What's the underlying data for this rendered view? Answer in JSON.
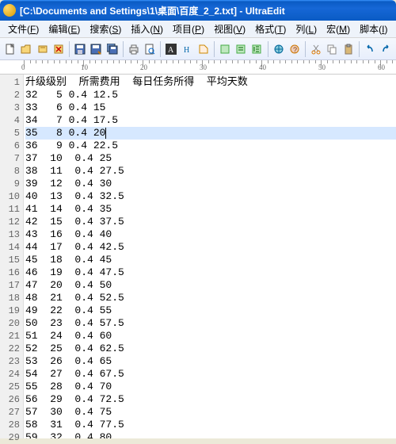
{
  "window": {
    "title": "[C:\\Documents and Settings\\1\\桌面\\百度_2_2.txt] - UltraEdit"
  },
  "menu": [
    {
      "label": "文件",
      "acc": "F"
    },
    {
      "label": "编辑",
      "acc": "E"
    },
    {
      "label": "搜索",
      "acc": "S"
    },
    {
      "label": "插入",
      "acc": "N"
    },
    {
      "label": "项目",
      "acc": "P"
    },
    {
      "label": "视图",
      "acc": "V"
    },
    {
      "label": "格式",
      "acc": "T"
    },
    {
      "label": "列",
      "acc": "L"
    },
    {
      "label": "宏",
      "acc": "M"
    },
    {
      "label": "脚本",
      "acc": "I"
    }
  ],
  "ruler": {
    "marks": [
      0,
      10,
      20,
      30,
      40,
      50,
      60
    ]
  },
  "selected_line": 5,
  "header_line": "升级级别  所需费用  每日任务所得  平均天数",
  "rows": [
    "32   5 0.4 12.5",
    "33   6 0.4 15",
    "34   7 0.4 17.5",
    "35   8 0.4 20",
    "36   9 0.4 22.5",
    "37  10  0.4 25",
    "38  11  0.4 27.5",
    "39  12  0.4 30",
    "40  13  0.4 32.5",
    "41  14  0.4 35",
    "42  15  0.4 37.5",
    "43  16  0.4 40",
    "44  17  0.4 42.5",
    "45  18  0.4 45",
    "46  19  0.4 47.5",
    "47  20  0.4 50",
    "48  21  0.4 52.5",
    "49  22  0.4 55",
    "50  23  0.4 57.5",
    "51  24  0.4 60",
    "52  25  0.4 62.5",
    "53  26  0.4 65",
    "54  27  0.4 67.5",
    "55  28  0.4 70",
    "56  29  0.4 72.5",
    "57  30  0.4 75",
    "58  31  0.4 77.5",
    "59  32  0.4 80"
  ]
}
